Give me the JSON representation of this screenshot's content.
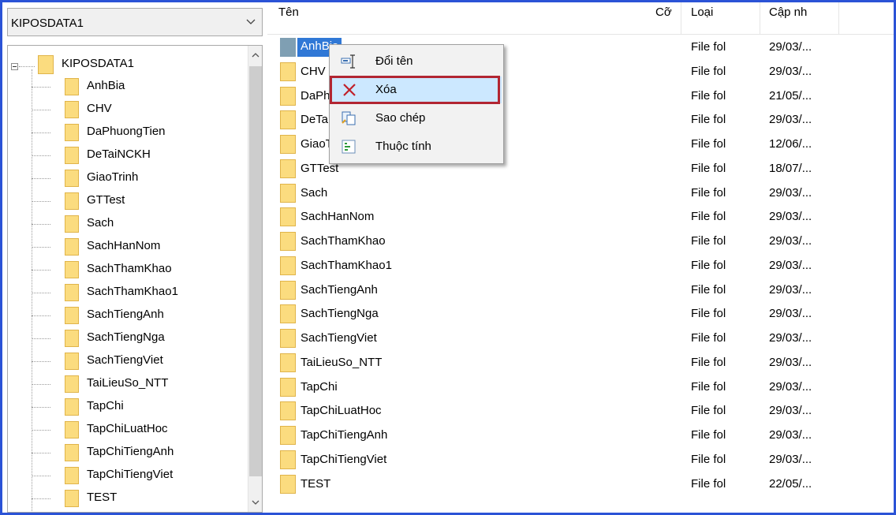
{
  "drive_select": {
    "value": "KIPOSDATA1"
  },
  "tree": {
    "root_label": "KIPOSDATA1",
    "items": [
      "AnhBia",
      "CHV",
      "DaPhuongTien",
      "DeTaiNCKH",
      "GiaoTrinh",
      "GTTest",
      "Sach",
      "SachHanNom",
      "SachThamKhao",
      "SachThamKhao1",
      "SachTiengAnh",
      "SachTiengNga",
      "SachTiengViet",
      "TaiLieuSo_NTT",
      "TapChi",
      "TapChiLuatHoc",
      "TapChiTiengAnh",
      "TapChiTiengViet",
      "TEST"
    ]
  },
  "list": {
    "columns": {
      "name": "Tên",
      "size": "Cỡ",
      "type": "Loại",
      "modified": "Cập nh"
    },
    "selected_name": "AnhBia",
    "rows": [
      {
        "name": "AnhBia",
        "type": "File fol",
        "date": "29/03/..."
      },
      {
        "name": "CHV",
        "type": "File fol",
        "date": "29/03/..."
      },
      {
        "name": "DaPhuongTien",
        "type": "File fol",
        "date": "21/05/..."
      },
      {
        "name": "DeTaiNCKH",
        "type": "File fol",
        "date": "29/03/..."
      },
      {
        "name": "GiaoTrinh",
        "type": "File fol",
        "date": "12/06/..."
      },
      {
        "name": "GTTest",
        "type": "File fol",
        "date": "18/07/..."
      },
      {
        "name": "Sach",
        "type": "File fol",
        "date": "29/03/..."
      },
      {
        "name": "SachHanNom",
        "type": "File fol",
        "date": "29/03/..."
      },
      {
        "name": "SachThamKhao",
        "type": "File fol",
        "date": "29/03/..."
      },
      {
        "name": "SachThamKhao1",
        "type": "File fol",
        "date": "29/03/..."
      },
      {
        "name": "SachTiengAnh",
        "type": "File fol",
        "date": "29/03/..."
      },
      {
        "name": "SachTiengNga",
        "type": "File fol",
        "date": "29/03/..."
      },
      {
        "name": "SachTiengViet",
        "type": "File fol",
        "date": "29/03/..."
      },
      {
        "name": "TaiLieuSo_NTT",
        "type": "File fol",
        "date": "29/03/..."
      },
      {
        "name": "TapChi",
        "type": "File fol",
        "date": "29/03/..."
      },
      {
        "name": "TapChiLuatHoc",
        "type": "File fol",
        "date": "29/03/..."
      },
      {
        "name": "TapChiTiengAnh",
        "type": "File fol",
        "date": "29/03/..."
      },
      {
        "name": "TapChiTiengViet",
        "type": "File fol",
        "date": "29/03/..."
      },
      {
        "name": "TEST",
        "type": "File fol",
        "date": "22/05/..."
      }
    ]
  },
  "context_menu": {
    "items": [
      {
        "label": "Đổi tên",
        "icon": "rename-icon"
      },
      {
        "label": "Xóa",
        "icon": "delete-icon"
      },
      {
        "label": "Sao chép",
        "icon": "copy-icon"
      },
      {
        "label": "Thuộc tính",
        "icon": "properties-icon"
      }
    ],
    "highlighted_index": 1
  },
  "colors": {
    "frame_border": "#2b53d6",
    "folder_fill": "#fbdc7f",
    "selection": "#3078d6",
    "menu_highlight": "#cce8ff",
    "annotation_box": "#b22632"
  }
}
